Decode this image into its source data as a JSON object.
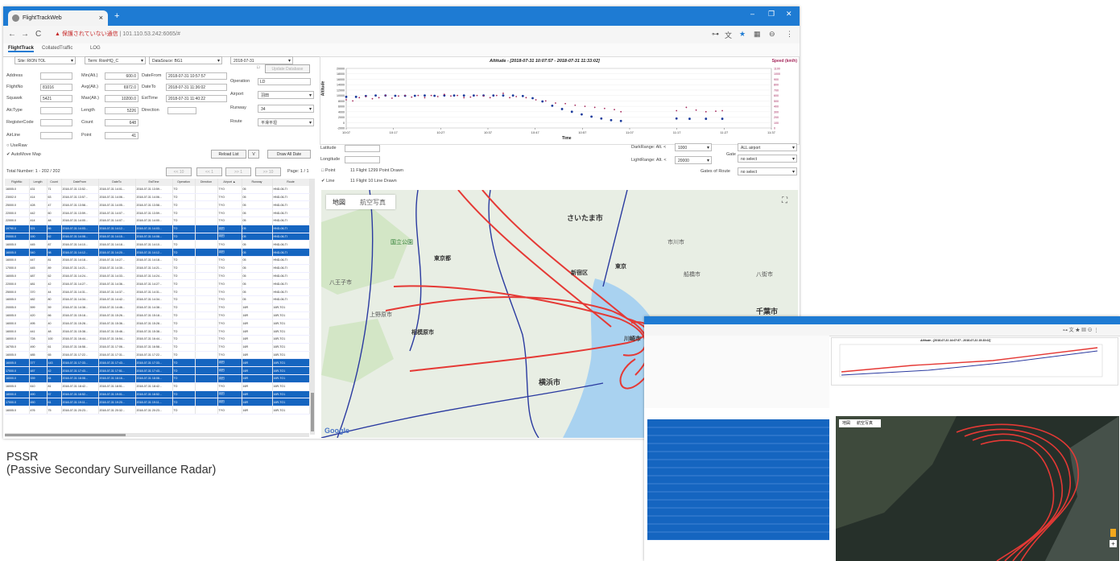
{
  "browser": {
    "tab_title": "FlightTrackWeb",
    "url_warning": "保護されていない通信",
    "url": "101.110.53.242:6065/#"
  },
  "app": {
    "tabs": [
      "FlightTrack",
      "CollatedTraffic",
      "LOG"
    ],
    "filters": {
      "site": "Site: RION TOL",
      "term": "Term: RionHQ_C",
      "datasource": "DataSouce: BG1",
      "date": "2018-07-31"
    },
    "form": {
      "address_label": "Address",
      "flightno_label": "FlightNo",
      "flightno": "81016",
      "squawk_label": "Squawk",
      "squawk": "5421",
      "atctype_label": "AtcType",
      "registercode_label": "RegisterCode",
      "airline_label": "AirLine",
      "minalt_label": "Min(Alt.)",
      "minalt": "600.0",
      "avgalt_label": "Avg(Alt.)",
      "avgalt": "6972.0",
      "maxalt_label": "Max(Alt.)",
      "maxalt": "10200.0",
      "length_label": "Length",
      "length": "5226",
      "count_label": "Count",
      "count": "648",
      "point_label": "Point",
      "point": "41",
      "datefrom_label": "DateFrom",
      "datefrom": "2018-07-31 10:57:57",
      "dateto_label": "DateTo",
      "dateto": "2018-07-31 11:36:02",
      "esttime_label": "EstTime",
      "esttime": "2018-07-31 11:40:22",
      "direction_label": "Direction",
      "update_db": "Update Database",
      "operation_label": "Operation",
      "operation": "LD",
      "airport_label": "Airport",
      "airport": "羽田",
      "runway_label": "Runway",
      "runway": "34",
      "route_label": "Route",
      "route": "平滑平坦",
      "useraw": "UseRaw",
      "automove": "AutoMove Map",
      "reload": "Reload List",
      "v_btn": "V",
      "draw_all": "Draw All Date"
    },
    "list": {
      "total": "Total Number: 1 - 202 / 202",
      "pager": [
        "<< 10",
        "<< 1",
        ">> 1",
        ">> 10"
      ],
      "page": "Page: 1 / 1",
      "columns": [
        "FlightNo",
        "Length",
        "Count",
        "DateFrom",
        "DateTo",
        "EstTime",
        "Operation",
        "Direction",
        "Airport ▲",
        "Runway",
        "Route"
      ],
      "rows": [
        [
          "16005.0",
          "431",
          "71",
          "2018-07-31 13:52...",
          "2018-07-31 14:01...",
          "2018-07-31 13:59...",
          "TO",
          "",
          "TYO",
          "05",
          "HND-06-TI"
        ],
        [
          "23002.0",
          "414",
          "63",
          "2018-07-31 13:57...",
          "2018-07-31 14:06...",
          "2018-07-31 14:06...",
          "TO",
          "",
          "TYO",
          "05",
          "HND-06-TI"
        ],
        [
          "25000.0",
          "428",
          "47",
          "2018-07-31 13:58...",
          "2018-07-31 14:05...",
          "2018-07-31 13:58...",
          "TO",
          "",
          "TYO",
          "05",
          "HND-06-TI"
        ],
        [
          "22000.0",
          "442",
          "60",
          "2018-07-31 13:59...",
          "2018-07-31 14:07...",
          "2018-07-31 13:59...",
          "TO",
          "",
          "TYO",
          "05",
          "HND-06-TI"
        ],
        [
          "22000.0",
          "414",
          "48",
          "2018-07-31 14:00...",
          "2018-07-31 14:07...",
          "2018-07-31 14:00...",
          "TO",
          "",
          "TYO",
          "05",
          "HND-06-TI"
        ],
        [
          "19790.0",
          "321",
          "86",
          "2018-07-31 14:03...",
          "2018-07-31 14:12...",
          "2018-07-31 14:03...",
          "TO",
          "",
          "羽田",
          "05",
          "HND-06-TI"
        ],
        [
          "20000.0",
          "190",
          "62",
          "2018-07-31 14:08...",
          "2018-07-31 14:15...",
          "2018-07-31 14:08...",
          "TO",
          "",
          "羽田",
          "05",
          "HND-06-TI"
        ],
        [
          "16005.0",
          "445",
          "87",
          "2018-07-31 14:10...",
          "2018-07-31 14:18...",
          "2018-07-31 14:10...",
          "TO",
          "",
          "TYO",
          "05",
          "HND-06-TI"
        ],
        [
          "16005.0",
          "540",
          "98",
          "2018-07-31 14:12...",
          "2018-07-31 14:20...",
          "2018-07-31 14:12...",
          "TO",
          "",
          "羽田",
          "05",
          "HND-06-TI"
        ],
        [
          "16000.0",
          "447",
          "81",
          "2018-07-31 14:18...",
          "2018-07-31 14:27...",
          "2018-07-31 14:18...",
          "TO",
          "",
          "TYO",
          "05",
          "HND-06-TI"
        ],
        [
          "17000.0",
          "445",
          "89",
          "2018-07-31 14:21...",
          "2018-07-31 14:30...",
          "2018-07-31 14:21...",
          "TO",
          "",
          "TYO",
          "05",
          "HND-06-TI"
        ],
        [
          "16005.0",
          "487",
          "62",
          "2018-07-31 14:24...",
          "2018-07-31 14:33...",
          "2018-07-31 14:24...",
          "TO",
          "",
          "TYO",
          "05",
          "HND-06-TI"
        ],
        [
          "22000.0",
          "481",
          "42",
          "2018-07-31 14:27...",
          "2018-07-31 14:36...",
          "2018-07-31 14:27...",
          "TO",
          "",
          "TYO",
          "05",
          "HND-06-TI"
        ],
        [
          "25000.0",
          "370",
          "44",
          "2018-07-31 14:31...",
          "2018-07-31 14:37...",
          "2018-07-31 14:31...",
          "TO",
          "",
          "TYO",
          "05",
          "HND-06-TI"
        ],
        [
          "16005.0",
          "482",
          "80",
          "2018-07-31 14:34...",
          "2018-07-31 14:42...",
          "2018-07-31 14:34...",
          "TO",
          "",
          "TYO",
          "05",
          "HND-06-TI"
        ],
        [
          "20005.0",
          "599",
          "59",
          "2018-07-31 14:38...",
          "2018-07-31 14:46...",
          "2018-07-31 14:38...",
          "TO",
          "",
          "TYO",
          "16R",
          "16R-TO1"
        ],
        [
          "16005.0",
          "420",
          "66",
          "2018-07-31 15:18...",
          "2018-07-31 15:26...",
          "2018-07-31 15:18...",
          "TO",
          "",
          "TYO",
          "16R",
          "16R-TO1"
        ],
        [
          "16000.0",
          "495",
          "40",
          "2018-07-31 15:28...",
          "2018-07-31 15:36...",
          "2018-07-31 15:28...",
          "TO",
          "",
          "TYO",
          "16R",
          "16R-TO1"
        ],
        [
          "16000.0",
          "441",
          "48",
          "2018-07-31 15:38...",
          "2018-07-31 15:46...",
          "2018-07-31 15:38...",
          "TO",
          "",
          "TYO",
          "16R",
          "16R-TO1"
        ],
        [
          "16000.0",
          "728",
          "100",
          "2018-07-31 16:44...",
          "2018-07-31 16:54...",
          "2018-07-31 16:44...",
          "TO",
          "",
          "TYO",
          "16R",
          "16R-TO1"
        ],
        [
          "16705.0",
          "490",
          "61",
          "2018-07-31 16:58...",
          "2018-07-31 17:06...",
          "2018-07-31 16:58...",
          "TO",
          "",
          "TYO",
          "16R",
          "16R-TO1"
        ],
        [
          "16005.0",
          "485",
          "65",
          "2018-07-31 17:22...",
          "2018-07-31 17:31...",
          "2018-07-31 17:22...",
          "TO",
          "",
          "TYO",
          "16R",
          "16R-TO1"
        ],
        [
          "16005.0",
          "377",
          "143",
          "2018-07-31 17:33...",
          "2018-07-31 17:43...",
          "2018-07-31 17:33...",
          "TO",
          "",
          "羽田",
          "16R",
          "16R-TO1"
        ],
        [
          "17000.0",
          "487",
          "42",
          "2018-07-31 17:43...",
          "2018-07-31 17:51...",
          "2018-07-31 17:43...",
          "TO",
          "",
          "羽田",
          "16R",
          "16R-TO1"
        ],
        [
          "16000.0",
          "339",
          "84",
          "2018-07-31 18:08...",
          "2018-07-31 18:16...",
          "2018-07-31 18:08...",
          "TO",
          "",
          "羽田",
          "16R",
          "16R-TO1"
        ],
        [
          "16005.0",
          "610",
          "81",
          "2018-07-31 18:42...",
          "2018-07-31 18:51...",
          "2018-07-31 18:42...",
          "TO",
          "",
          "TYO",
          "16R",
          "16R-TO1"
        ],
        [
          "18000.0",
          "490",
          "57",
          "2018-07-31 18:52...",
          "2018-07-31 19:01...",
          "2018-07-31 18:52...",
          "TO",
          "",
          "羽田",
          "16R",
          "16R-TO1"
        ],
        [
          "17000.0",
          "450",
          "61",
          "2018-07-31 19:11...",
          "2018-07-31 19:20...",
          "2018-07-31 19:11...",
          "TO",
          "",
          "羽田",
          "16R",
          "16R-TO1"
        ],
        [
          "16005.0",
          "476",
          "75",
          "2018-07-31 20:23...",
          "2018-07-31 20:32...",
          "2018-07-31 20:23...",
          "TO",
          "",
          "TYO",
          "16R",
          "16R-TO1"
        ]
      ],
      "highlight_rows": [
        5,
        6,
        8,
        22,
        23,
        24,
        26,
        27
      ]
    },
    "chart": {
      "title": "Altitude - [2018-07-31 10:07:57 - 2018-07-31 11:33:02]",
      "ylabel": "Altitude",
      "y2label": "Speed (km/h)",
      "xlabel": "Time"
    },
    "coords": {
      "lat_label": "Latitude",
      "lon_label": "Longitude"
    },
    "draw": {
      "point": "Point",
      "point_text": "11 Flight 1299 Point Drawn",
      "line": "Line",
      "line_text": "11 Flight 10 Line Drawn"
    },
    "ranges": {
      "dark_label": "DarkRange: Alt. <",
      "dark": "1000",
      "light_label": "LightRange: Alt. <",
      "light": "20000",
      "gate_label": "Gate",
      "gate1": "ALL airport",
      "gate2": "no select",
      "gates_route_label": "Gates of Route",
      "gates_route": "no select"
    },
    "map": {
      "tabs": [
        "地図",
        "航空写真"
      ],
      "places": [
        "さいたま市",
        "東京都",
        "新宿区",
        "東京",
        "千葉市",
        "相模原市",
        "川崎市",
        "横浜市",
        "八王子市",
        "国立公園",
        "船橋市",
        "市川市",
        "上野原市",
        "八街市"
      ],
      "google": "Google"
    }
  },
  "second_window": {
    "title": "Altitude - [2018-07-31 14:07:57 - 2018-07-31 15:33:02]",
    "map_tabs": [
      "地図",
      "航空写真"
    ]
  },
  "caption": {
    "line1": "PSSR",
    "line2": "(Passive Secondary Surveillance Radar)"
  },
  "colors": {
    "titlebar": "#1e7bd3",
    "selection": "#1565c0",
    "track_red": "#e53935",
    "track_blue": "#283593"
  },
  "chart_data": {
    "type": "scatter",
    "title": "Altitude - [2018-07-31 10:07:57 - 2018-07-31 11:33:02]",
    "xlabel": "Time",
    "ylabel": "Altitude",
    "y2label": "Speed (km/h)",
    "x_ticks": [
      "10:07",
      "10:17",
      "10:27",
      "10:37",
      "10:47",
      "10:57",
      "11:07",
      "11:17",
      "11:27",
      "11:37"
    ],
    "y_ticks": [
      "-2000",
      "0",
      "2000",
      "4000",
      "6000",
      "8000",
      "10000",
      "12000",
      "14000",
      "16000",
      "18000",
      "20000"
    ],
    "y2_ticks": [
      "0",
      "100",
      "200",
      "300",
      "400",
      "500",
      "600",
      "700",
      "800",
      "900",
      "1000",
      "1100"
    ],
    "ylim": [
      -2000,
      20000
    ],
    "y2lim": [
      0,
      1100
    ],
    "series": [
      {
        "name": "Altitude",
        "color": "#1a3a9c",
        "points": [
          [
            0,
            9500
          ],
          [
            3,
            9500
          ],
          [
            6,
            9800
          ],
          [
            9,
            10000
          ],
          [
            12,
            10000
          ],
          [
            15,
            9900
          ],
          [
            18,
            9900
          ],
          [
            21,
            9900
          ],
          [
            24,
            10000
          ],
          [
            27,
            9900
          ],
          [
            30,
            10000
          ],
          [
            33,
            10000
          ],
          [
            36,
            10000
          ],
          [
            39,
            10000
          ],
          [
            42,
            10000
          ],
          [
            45,
            10000
          ],
          [
            48,
            10000
          ],
          [
            51,
            10000
          ],
          [
            54,
            9800
          ],
          [
            57,
            9000
          ],
          [
            60,
            7800
          ],
          [
            63,
            6200
          ],
          [
            66,
            5000
          ],
          [
            69,
            4000
          ],
          [
            72,
            3000
          ],
          [
            75,
            2200
          ],
          [
            78,
            1500
          ],
          [
            81,
            900
          ],
          [
            84,
            600
          ],
          [
            101,
            1500
          ],
          [
            105,
            1400
          ],
          [
            110,
            1400
          ],
          [
            115,
            1400
          ]
        ]
      },
      {
        "name": "Speed",
        "color": "#a4265a",
        "points": [
          [
            0,
            520
          ],
          [
            2,
            500
          ],
          [
            4,
            560
          ],
          [
            6,
            580
          ],
          [
            8,
            540
          ],
          [
            10,
            560
          ],
          [
            12,
            600
          ],
          [
            14,
            550
          ],
          [
            16,
            590
          ],
          [
            18,
            600
          ],
          [
            20,
            570
          ],
          [
            22,
            600
          ],
          [
            24,
            560
          ],
          [
            26,
            600
          ],
          [
            28,
            580
          ],
          [
            30,
            620
          ],
          [
            32,
            590
          ],
          [
            34,
            600
          ],
          [
            36,
            560
          ],
          [
            38,
            570
          ],
          [
            40,
            600
          ],
          [
            42,
            590
          ],
          [
            44,
            560
          ],
          [
            46,
            600
          ],
          [
            48,
            640
          ],
          [
            50,
            560
          ],
          [
            52,
            580
          ],
          [
            55,
            560
          ],
          [
            58,
            520
          ],
          [
            61,
            500
          ],
          [
            64,
            460
          ],
          [
            67,
            450
          ],
          [
            70,
            420
          ],
          [
            73,
            400
          ],
          [
            76,
            380
          ],
          [
            79,
            360
          ],
          [
            82,
            340
          ],
          [
            84,
            300
          ],
          [
            101,
            320
          ],
          [
            104,
            380
          ],
          [
            107,
            330
          ],
          [
            110,
            300
          ],
          [
            113,
            310
          ],
          [
            115,
            320
          ]
        ]
      }
    ]
  }
}
